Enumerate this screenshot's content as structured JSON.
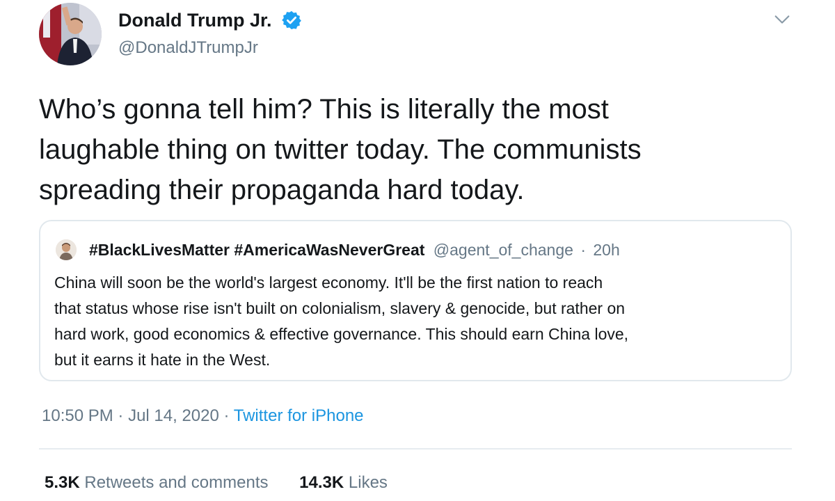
{
  "author": {
    "name": "Donald Trump Jr.",
    "handle": "@DonaldJTrumpJr",
    "verified": true,
    "verified_color": "#1da1f2"
  },
  "tweet": {
    "lines": [
      "Who’s gonna tell him?  This is literally the most",
      "laughable thing on twitter today. The communists",
      "spreading their propaganda hard today."
    ]
  },
  "quoted_tweet": {
    "name": "#BlackLivesMatter #AmericaWasNeverGreat",
    "handle": "@agent_of_change",
    "separator": "·",
    "time": "20h",
    "lines": [
      "China will soon be the world's largest economy. It'll be the first nation to reach",
      "that status whose rise isn't built on colonialism, slavery & genocide, but rather on",
      "hard work, good economics & effective governance. This should earn China love,",
      "but it earns it hate in the West."
    ]
  },
  "meta": {
    "time": "10:50 PM",
    "separator": "·",
    "date": "Jul 14, 2020",
    "source": "Twitter for iPhone"
  },
  "stats": {
    "retweets_count": "5.3K",
    "retweets_label": "Retweets and comments",
    "likes_count": "14.3K",
    "likes_label": "Likes"
  },
  "icons": {
    "verified": "verified-badge-icon",
    "menu": "chevron-down-icon"
  },
  "colors": {
    "text": "#14171a",
    "secondary": "#657786",
    "link": "#1b95e0",
    "border": "#e1e8ed"
  }
}
